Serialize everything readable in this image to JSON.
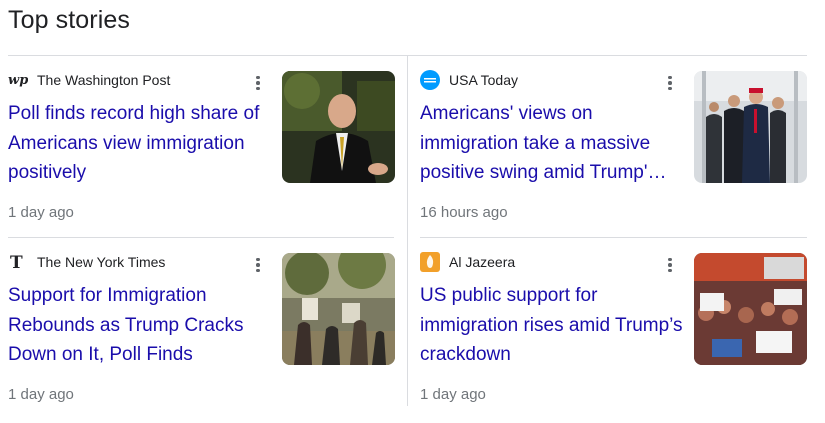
{
  "section": {
    "title": "Top stories"
  },
  "stories": [
    {
      "source": "The Washington Post",
      "logo_icon": "washington-post-logo-icon",
      "headline": "Poll finds record high share of Americans view immigration positively",
      "time": "1 day ago"
    },
    {
      "source": "USA Today",
      "logo_icon": "usa-today-logo-icon",
      "headline": "Americans' views on immigration take a massive positive swing amid Trump'…",
      "time": "16 hours ago"
    },
    {
      "source": "The New York Times",
      "logo_icon": "new-york-times-logo-icon",
      "headline": "Support for Immigration Rebounds as Trump Cracks Down on It, Poll Finds",
      "time": "1 day ago"
    },
    {
      "source": "Al Jazeera",
      "logo_icon": "al-jazeera-logo-icon",
      "headline": "US public support for immigration rises amid Trump’s crackdown",
      "time": "1 day ago"
    }
  ],
  "colors": {
    "headline_link": "#1a0dab",
    "meta_text": "#70757a",
    "divider": "#dadce0",
    "usa_today_blue": "#009bff",
    "al_jazeera_orange": "#f2a02a"
  }
}
